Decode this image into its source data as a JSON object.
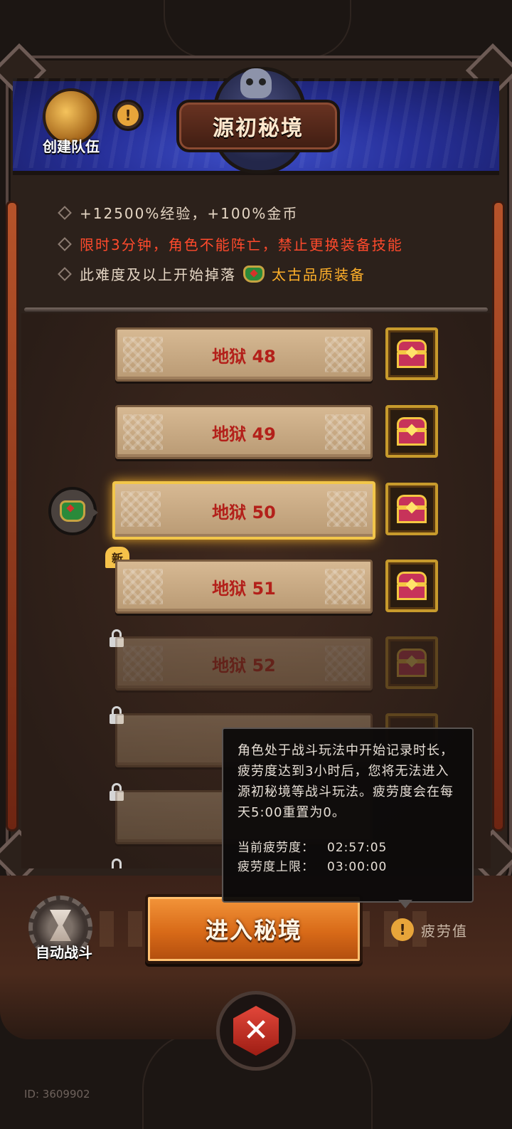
{
  "header": {
    "team_label": "创建队伍",
    "info_icon": "!",
    "title": "源初秘境"
  },
  "info_lines": {
    "line1": "+12500%经验，+100%金币",
    "line2": "限时3分钟，角色不能阵亡，禁止更换装备技能",
    "line3_prefix": "此难度及以上开始掉落",
    "line3_quality": "太古品质装备"
  },
  "levels": [
    {
      "label": "地狱 48",
      "state": "available"
    },
    {
      "label": "地狱 49",
      "state": "available"
    },
    {
      "label": "地狱 50",
      "state": "selected"
    },
    {
      "label": "地狱 51",
      "state": "new"
    },
    {
      "label": "地狱 52",
      "state": "locked"
    }
  ],
  "new_badge": "新",
  "tooltip": {
    "text": "角色处于战斗玩法中开始记录时长，疲劳度达到3小时后，您将无法进入源初秘境等战斗玩法。疲劳度会在每天5:00重置为0。",
    "current_label": "当前疲劳度：",
    "current_value": "02:57:05",
    "limit_label": "疲劳度上限：",
    "limit_value": "03:00:00"
  },
  "bottom": {
    "auto_battle_label": "自动战斗",
    "enter_label": "进入秘境",
    "fatigue_icon": "!",
    "fatigue_label": "疲劳值",
    "user_id": "ID: 3609902"
  },
  "colors": {
    "accent_red": "#ff4a2c",
    "accent_gold": "#ffb02a",
    "enter_orange": "#d86a18",
    "banner_blue": "#27309a"
  },
  "icons": [
    "axe-team-icon",
    "info-icon",
    "skull-emblem-icon",
    "chest-icon",
    "gem-armor-icon",
    "lock-icon",
    "gear-hourglass-icon",
    "crossed-swords-icon"
  ]
}
